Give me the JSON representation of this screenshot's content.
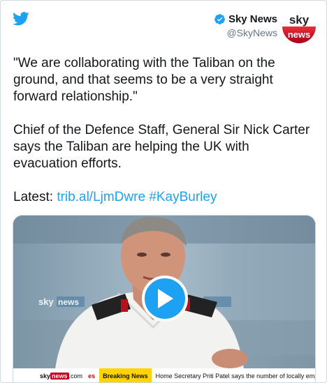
{
  "header": {
    "author_name": "Sky News",
    "handle": "@SkyNews",
    "avatar": {
      "top_text": "sky",
      "bottom_text": "news"
    },
    "colors": {
      "twitter_blue": "#1da1f2",
      "sky_red": "#c4001a"
    }
  },
  "tweet": {
    "quote": "\"We are collaborating with the Taliban on the ground, and that seems to be a very straight forward relationship.\"",
    "body": "Chief of the Defence Staff, General Sir Nick Carter says the Taliban are helping the UK with evacuation efforts.",
    "latest_label": "Latest:",
    "link_url": "trib.al/LjmDwre",
    "hashtag": "#KayBurley"
  },
  "media": {
    "bg_logo_sky": "sky",
    "bg_logo_news": "news",
    "ticker": {
      "logo_sky": "sky",
      "logo_news": "news",
      "logo_domain": ".com",
      "fragment": "es",
      "breaking_label": "Breaking News",
      "headline": "Home Secretary Priti Patel says the number of locally employ"
    }
  }
}
